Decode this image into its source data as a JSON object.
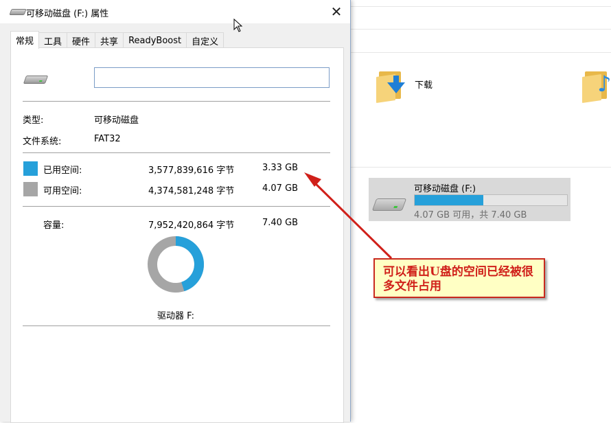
{
  "dialog": {
    "title": "可移动磁盘 (F:) 属性",
    "close_glyph": "✕",
    "tabs": [
      "常规",
      "工具",
      "硬件",
      "共享",
      "ReadyBoost",
      "自定义"
    ],
    "active_tab": "常规",
    "label_value": "",
    "type_label": "类型:",
    "type_value": "可移动磁盘",
    "fs_label": "文件系统:",
    "fs_value": "FAT32",
    "used": {
      "label": "已用空间:",
      "bytes": "3,577,839,616 字节",
      "size": "3.33 GB",
      "color": "#26a0da"
    },
    "free": {
      "label": "可用空间:",
      "bytes": "4,374,581,248 字节",
      "size": "4.07 GB",
      "color": "#a6a6a6"
    },
    "capacity": {
      "label": "容量:",
      "bytes": "7,952,420,864 字节",
      "size": "7.40 GB"
    },
    "used_fraction": 0.45,
    "drive_label": "驱动器 F:"
  },
  "explorer": {
    "folders": [
      {
        "name": "下载",
        "icon": "download-folder-icon"
      },
      {
        "name": "",
        "icon": "music-folder-icon"
      }
    ],
    "drive": {
      "name": "可移动磁盘 (F:)",
      "used_fraction": 0.45,
      "status": "4.07 GB 可用，共 7.40 GB"
    }
  },
  "annotation": {
    "text": "可以看出U盘的空间已经被很多文件占用"
  }
}
